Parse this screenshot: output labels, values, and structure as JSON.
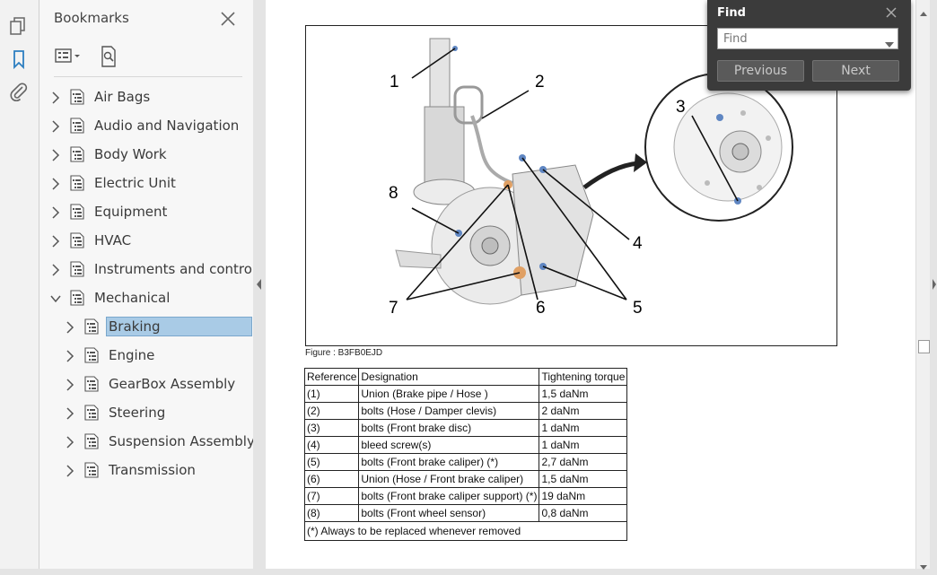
{
  "sidebar": {
    "title": "Bookmarks",
    "items": [
      {
        "label": "Air Bags",
        "level": 0,
        "expanded": false
      },
      {
        "label": "Audio and Navigation",
        "level": 0,
        "expanded": false
      },
      {
        "label": "Body Work",
        "level": 0,
        "expanded": false
      },
      {
        "label": "Electric Unit",
        "level": 0,
        "expanded": false
      },
      {
        "label": "Equipment",
        "level": 0,
        "expanded": false
      },
      {
        "label": "HVAC",
        "level": 0,
        "expanded": false
      },
      {
        "label": "Instruments and controls",
        "level": 0,
        "expanded": false
      },
      {
        "label": "Mechanical",
        "level": 0,
        "expanded": true
      },
      {
        "label": "Braking",
        "level": 1,
        "expanded": false,
        "selected": true
      },
      {
        "label": "Engine",
        "level": 1,
        "expanded": false
      },
      {
        "label": "GearBox Assembly",
        "level": 1,
        "expanded": false
      },
      {
        "label": "Steering",
        "level": 1,
        "expanded": false
      },
      {
        "label": "Suspension Assembly",
        "level": 1,
        "expanded": false
      },
      {
        "label": "Transmission",
        "level": 1,
        "expanded": false
      }
    ]
  },
  "find": {
    "title": "Find",
    "placeholder": "Find",
    "previous_label": "Previous",
    "next_label": "Next"
  },
  "document": {
    "figure_caption": "Figure : B3FB0EJD",
    "callouts": [
      "1",
      "2",
      "3",
      "4",
      "5",
      "6",
      "7",
      "8"
    ],
    "table": {
      "headers": [
        "Reference",
        "Designation",
        "Tightening torque"
      ],
      "rows": [
        [
          "(1)",
          "Union (Brake pipe / Hose )",
          "1,5 daNm"
        ],
        [
          "(2)",
          "bolts (Hose / Damper clevis)",
          "2 daNm"
        ],
        [
          "(3)",
          "bolts (Front brake disc)",
          "1 daNm"
        ],
        [
          "(4)",
          "bleed screw(s)",
          "1 daNm"
        ],
        [
          "(5)",
          "bolts (Front brake caliper) (*)",
          "2,7 daNm"
        ],
        [
          "(6)",
          "Union (Hose / Front brake caliper)",
          "1,5 daNm"
        ],
        [
          "(7)",
          "bolts (Front brake caliper support) (*)",
          "19 daNm"
        ],
        [
          "(8)",
          "bolts (Front wheel sensor)",
          "0,8 daNm"
        ]
      ],
      "footnote": "(*) Always to be replaced whenever removed"
    }
  }
}
